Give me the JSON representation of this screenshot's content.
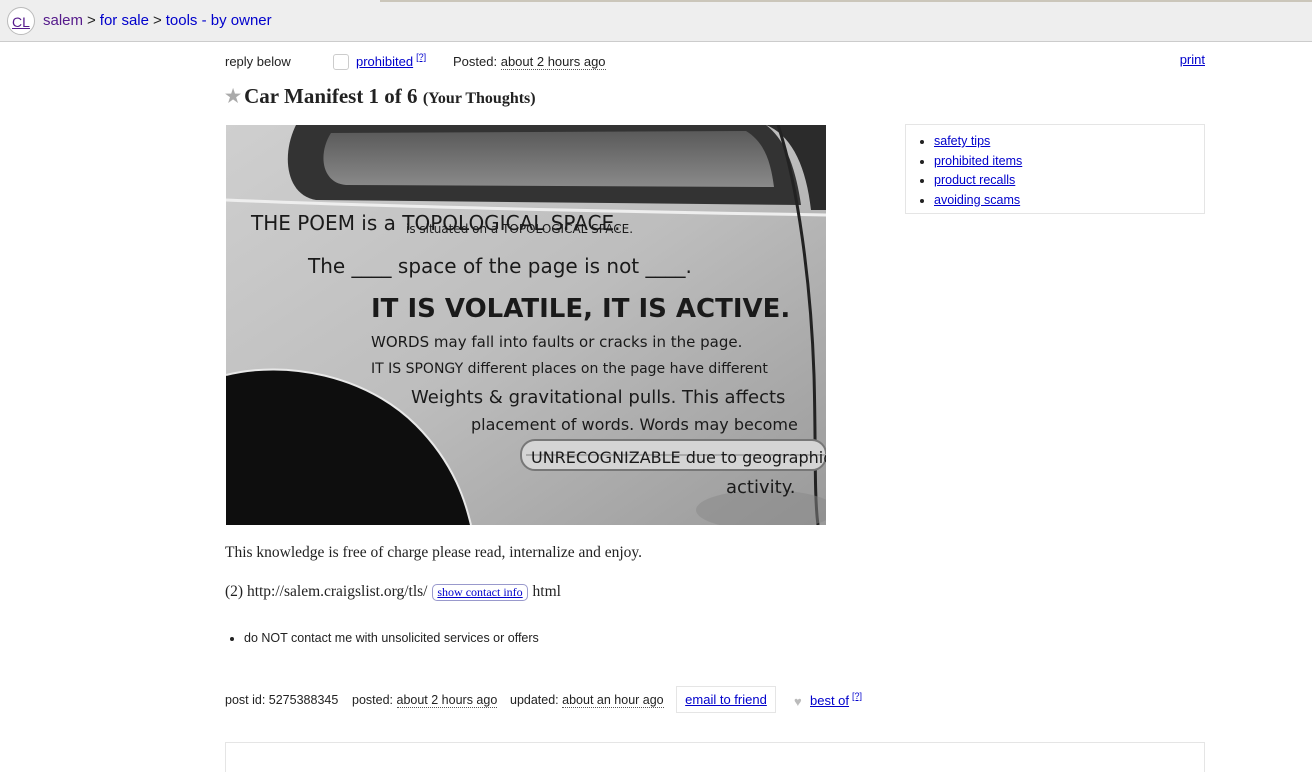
{
  "header": {
    "logo": "CL",
    "breadcrumbs": [
      "salem",
      "for sale",
      "tools - by owner"
    ],
    "separator": ">"
  },
  "posting_bar": {
    "reply": "reply below",
    "prohibited": "prohibited",
    "prohibited_help": "[?]",
    "posted_label": "Posted:",
    "posted_time": "about 2 hours ago",
    "print": "print"
  },
  "posting": {
    "title": "Car Manifest 1 of 6",
    "title_suffix": "(Your Thoughts)",
    "body": "This knowledge is free of charge please read, internalize and enjoy.",
    "link_prefix": "(2) http://salem.craigslist.org/tls/",
    "show_contact": "show contact info",
    "link_suffix": "html",
    "notice": "do NOT contact me with unsolicited services or offers"
  },
  "photo": {
    "lines": [
      "THE POEM is a TOPOLOGICAL SPACE.",
      "is situated on a TOPOLOGICAL SPACE.",
      "The ____ space of the page is not ____.",
      "IT IS VOLATILE, IT IS ACTIVE.",
      "WORDS may fall into faults or cracks in the page.",
      "IT IS SPONGY different places on the page have different",
      "Weights & gravitational pulls. This affects",
      "placement of words. Words may become",
      "UNRECOGNIZABLE due to geographic",
      "activity."
    ]
  },
  "safety_links": [
    "safety tips",
    "prohibited items",
    "product recalls",
    "avoiding scams"
  ],
  "postinfo": {
    "post_id": "post id: 5275388345",
    "posted_label": "posted:",
    "posted_time": "about 2 hours ago",
    "updated_label": "updated:",
    "updated_time": "about an hour ago",
    "email_friend": "email to friend",
    "best_of": "best of",
    "best_of_help": "[?]"
  }
}
